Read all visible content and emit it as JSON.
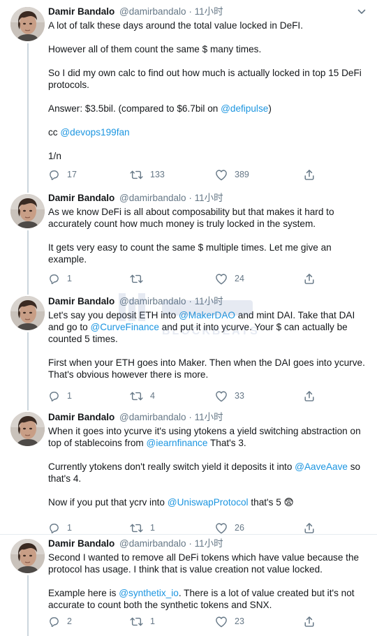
{
  "author": {
    "name": "Damir Bandalo",
    "handle": "@damirbandalo",
    "separator": "·",
    "time": "11小时"
  },
  "tweets": [
    {
      "paragraphs": [
        [
          {
            "t": "A lot of talk these days around the total value locked in DeFI."
          }
        ],
        [
          {
            "t": "However all of them count the same $ many times."
          }
        ],
        [
          {
            "t": "So I did my own calc to find out how much is actually locked in top 15 DeFi protocols."
          }
        ],
        [
          {
            "t": "Answer: $3.5bil. (compared to $6.7bil on "
          },
          {
            "m": "@defipulse"
          },
          {
            "t": ")"
          }
        ],
        [
          {
            "t": "cc "
          },
          {
            "m": "@devops199fan"
          }
        ],
        [
          {
            "t": "1/n"
          }
        ]
      ],
      "replies": "17",
      "retweets": "133",
      "likes": "389"
    },
    {
      "paragraphs": [
        [
          {
            "t": "As we know DeFi is all about composability but that makes it hard to accurately count how much money is truly locked in the system."
          }
        ],
        [
          {
            "t": "It gets very easy to count the same $ multiple times. Let me give an example."
          }
        ]
      ],
      "replies": "1",
      "retweets": "",
      "likes": "24"
    },
    {
      "paragraphs": [
        [
          {
            "t": "Let's say you deposit ETH into "
          },
          {
            "m": "@MakerDAO"
          },
          {
            "t": "  and mint DAI. Take that DAI and go to "
          },
          {
            "m": "@CurveFinance"
          },
          {
            "t": " and put it into ycurve. Your $ can actually be counted 5 times."
          }
        ],
        [
          {
            "t": "First when your ETH goes into Maker. Then when the DAI goes into ycurve. That's obvious however there is more."
          }
        ]
      ],
      "replies": "1",
      "retweets": "4",
      "likes": "33"
    },
    {
      "paragraphs": [
        [
          {
            "t": "When it goes into ycurve it's using ytokens a yield switching abstraction on top of stablecoins from "
          },
          {
            "m": "@iearnfinance"
          },
          {
            "t": " That's 3."
          }
        ],
        [
          {
            "t": "Currently ytokens don't really switch yield it deposits it into "
          },
          {
            "m": "@AaveAave"
          },
          {
            "t": " so that's 4."
          }
        ],
        [
          {
            "t": "Now if you put that ycrv into "
          },
          {
            "m": "@UniswapProtocol"
          },
          {
            "t": " that's 5 "
          },
          {
            "e": "😨"
          }
        ]
      ],
      "replies": "1",
      "retweets": "1",
      "likes": "26"
    },
    {
      "paragraphs": [
        [
          {
            "t": "Second I wanted to remove all DeFi tokens which have value because the protocol has usage. I think that is value creation not value locked."
          }
        ],
        [
          {
            "t": "Example here is "
          },
          {
            "m": "@synthetix_io"
          },
          {
            "t": ". There is a lot of value created but it's not accurate to count both the synthetic tokens and SNX."
          }
        ]
      ],
      "replies": "2",
      "retweets": "1",
      "likes": "23"
    }
  ],
  "watermark": {
    "text": "BLOCKBEATS"
  },
  "colors": {
    "mention": "#1b95e0",
    "muted": "#657786",
    "text": "#14171a",
    "thread_line": "#ccd6dd",
    "divider": "#e6ecf0"
  },
  "icons": {
    "reply": "speech-bubble-icon",
    "retweet": "retweet-arrows-icon",
    "like": "heart-icon",
    "share": "share-upload-icon",
    "menu": "chevron-down-icon"
  }
}
